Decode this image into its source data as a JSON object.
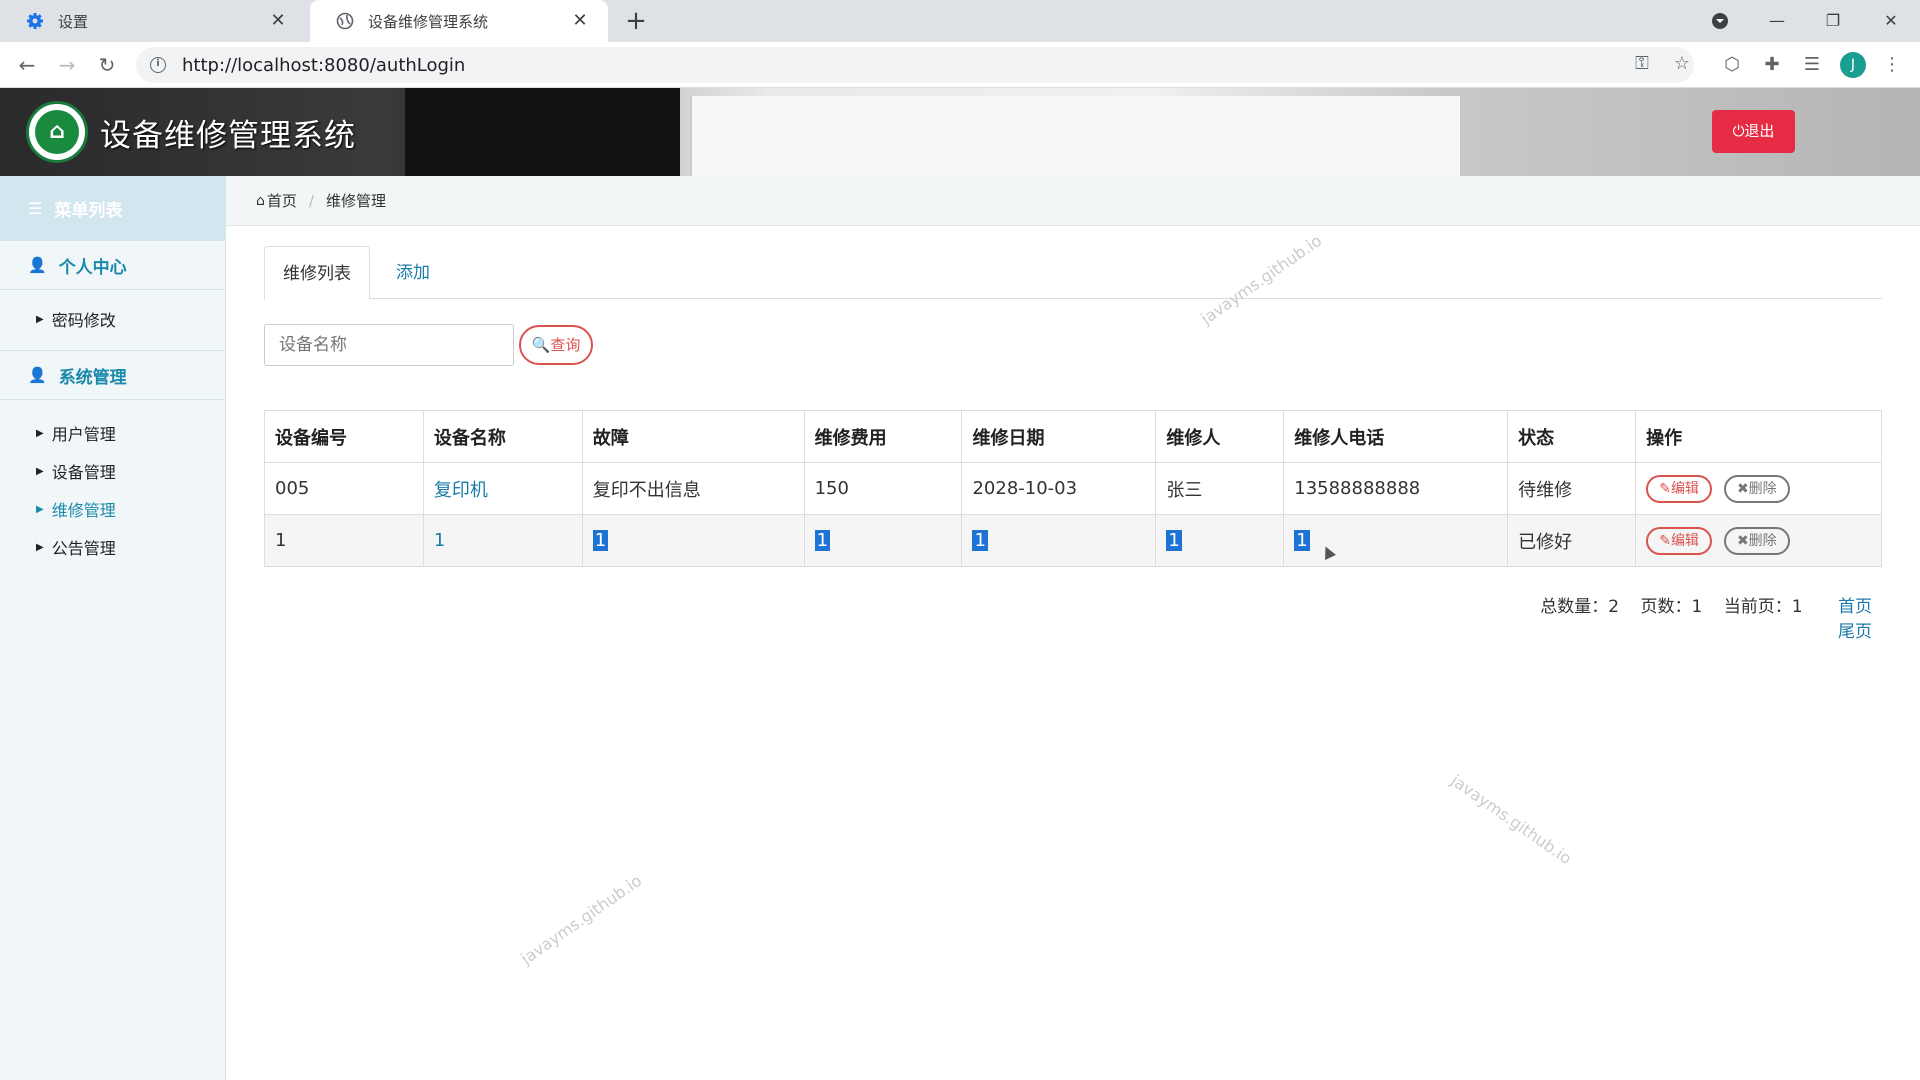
{
  "browser": {
    "tabs": [
      {
        "title": "设置",
        "icon": "gear-icon"
      },
      {
        "title": "设备维修管理系统",
        "icon": "globe-icon"
      }
    ],
    "url": "http://localhost:8080/authLogin",
    "avatar_letter": "J"
  },
  "header": {
    "title": "设备维修管理系统",
    "logout_label": "⏻退出"
  },
  "sidebar": {
    "menu_title": "菜单列表",
    "groups": [
      {
        "label": "个人中心",
        "items": [
          "密码修改"
        ]
      },
      {
        "label": "系统管理",
        "items": [
          "用户管理",
          "设备管理",
          "维修管理",
          "公告管理"
        ]
      }
    ],
    "active_item": "维修管理"
  },
  "breadcrumb": {
    "home": "首页",
    "current": "维修管理"
  },
  "tabs": {
    "list": "维修列表",
    "add": "添加"
  },
  "search": {
    "placeholder": "设备名称",
    "button": "查询"
  },
  "table": {
    "columns": [
      "设备编号",
      "设备名称",
      "故障",
      "维修费用",
      "维修日期",
      "维修人",
      "维修人电话",
      "状态",
      "操作"
    ],
    "rows": [
      {
        "code": "005",
        "name": "复印机",
        "fault": "复印不出信息",
        "cost": "150",
        "date": "2028-10-03",
        "person": "张三",
        "phone": "13588888888",
        "status": "待维修"
      },
      {
        "code": "1",
        "name": "1",
        "fault": "1",
        "cost": "1",
        "date": "1",
        "person": "1",
        "phone": "1",
        "status": "已修好"
      }
    ],
    "edit_label": "编辑",
    "delete_label": "删除"
  },
  "pager": {
    "total": "总数量：2",
    "pages": "页数：1",
    "current": "当前页：1",
    "first": "首页",
    "last": "尾页"
  },
  "watermark": "javayms.github.io",
  "colors": {
    "accent": "#1a8aaa",
    "danger": "#e62b45",
    "selection": "#1e74d4"
  }
}
